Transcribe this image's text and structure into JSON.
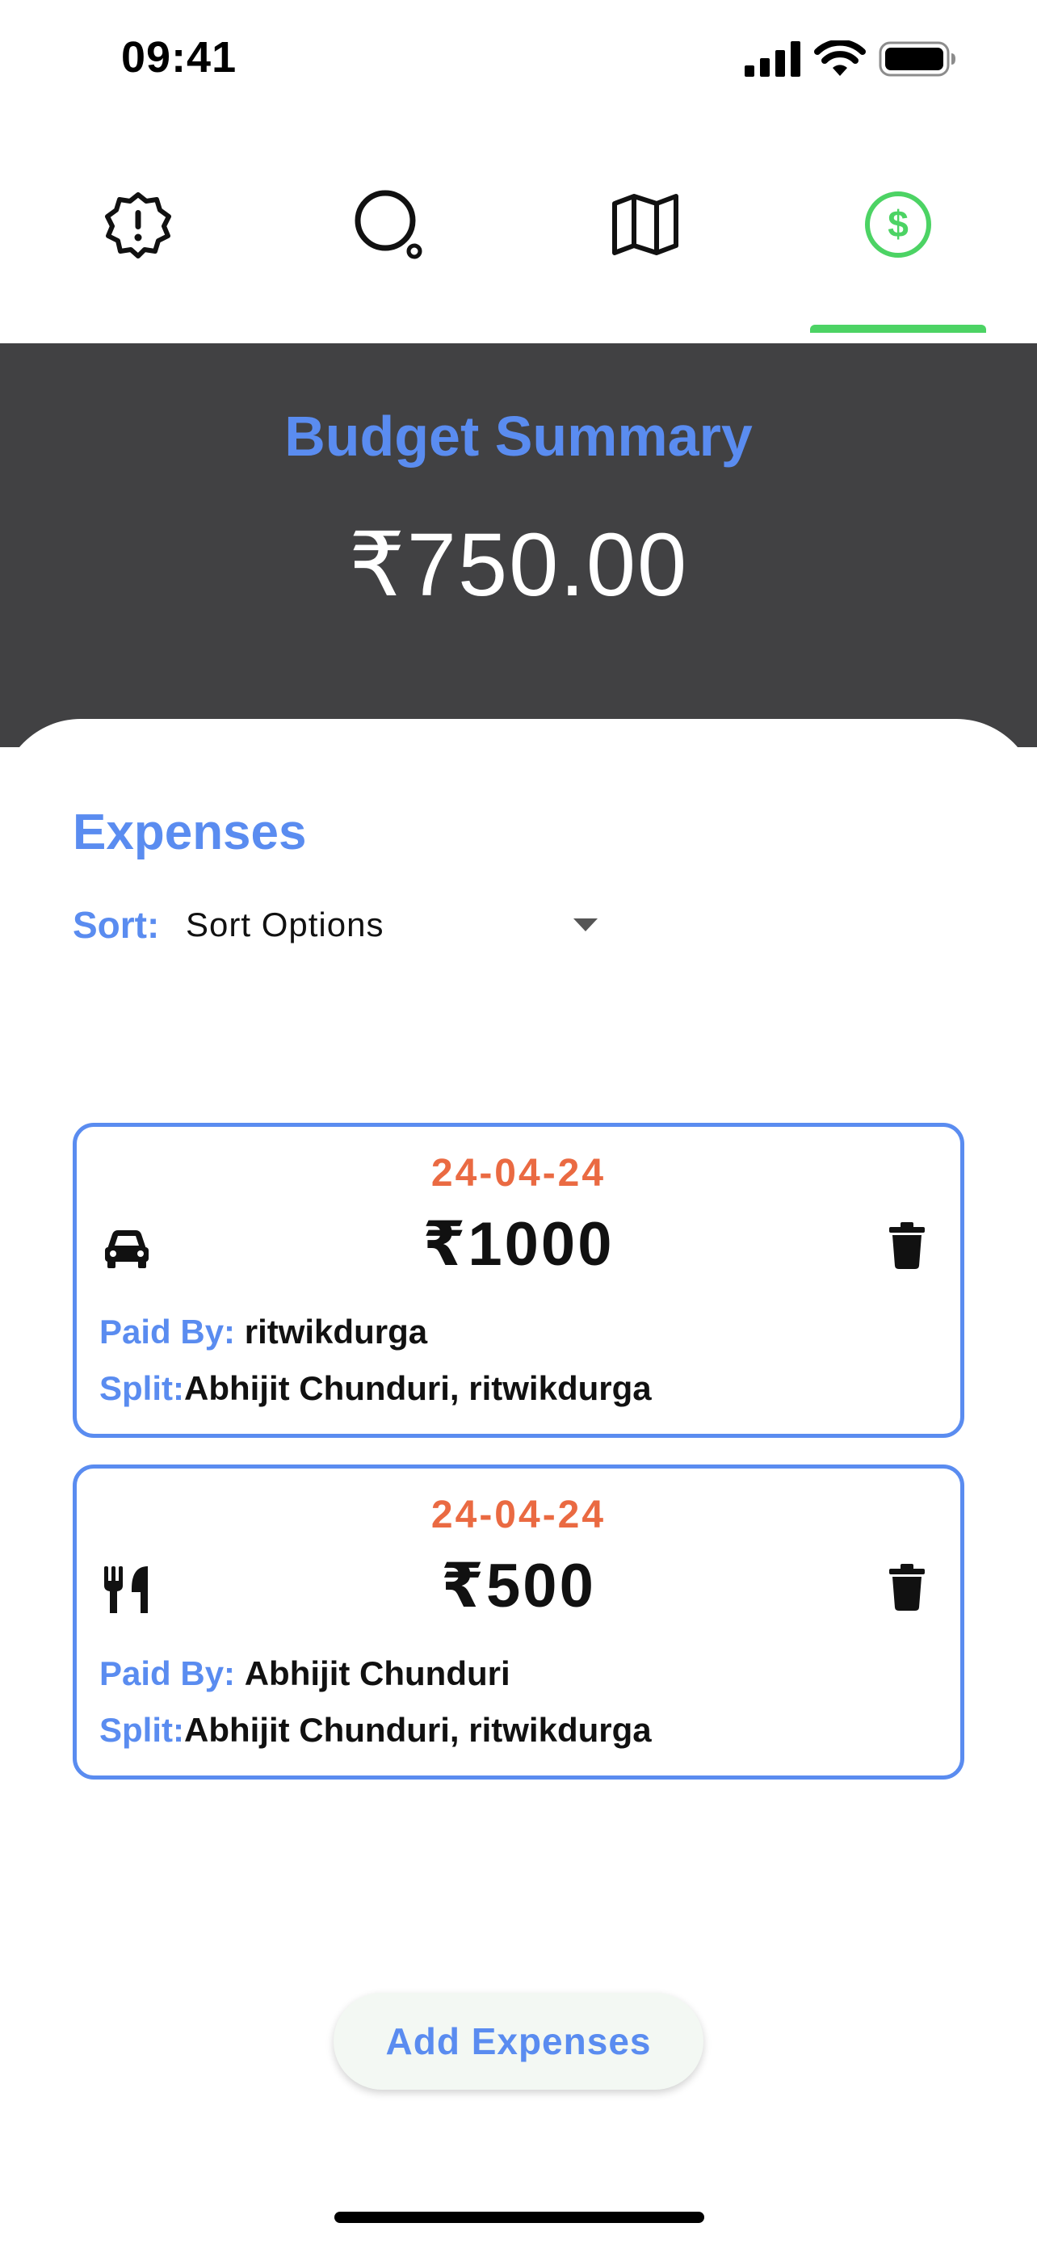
{
  "status_bar": {
    "time": "09:41",
    "icons": [
      "cellular-signal-icon",
      "wifi-icon",
      "battery-icon"
    ]
  },
  "tabs": {
    "items": [
      {
        "icon": "alert-badge-icon",
        "active": false
      },
      {
        "icon": "search-icon",
        "active": false
      },
      {
        "icon": "map-icon",
        "active": false
      },
      {
        "icon": "dollar-circle-icon",
        "active": true
      }
    ],
    "active_color": "#4cd364",
    "inactive_color": "#111111"
  },
  "summary": {
    "title": "Budget Summary",
    "amount": "₹750.00"
  },
  "expenses": {
    "title": "Expenses",
    "sort_label": "Sort:",
    "sort_value": "Sort Options",
    "paid_by_label": "Paid By:",
    "split_label": "Split:",
    "items": [
      {
        "date": "24-04-24",
        "amount": "₹1000",
        "category_icon": "car-icon",
        "paid_by": "ritwikdurga",
        "split": "Abhijit Chunduri, ritwikdurga"
      },
      {
        "date": "24-04-24",
        "amount": "₹500",
        "category_icon": "fork-knife-icon",
        "paid_by": "Abhijit Chunduri",
        "split": "Abhijit Chunduri, ritwikdurga"
      }
    ]
  },
  "add_button": {
    "label": "Add Expenses"
  },
  "colors": {
    "accent_blue": "#5a8cf0",
    "date_orange": "#ea6a42",
    "header_dark": "#414143",
    "tab_active_green": "#4cd364"
  }
}
